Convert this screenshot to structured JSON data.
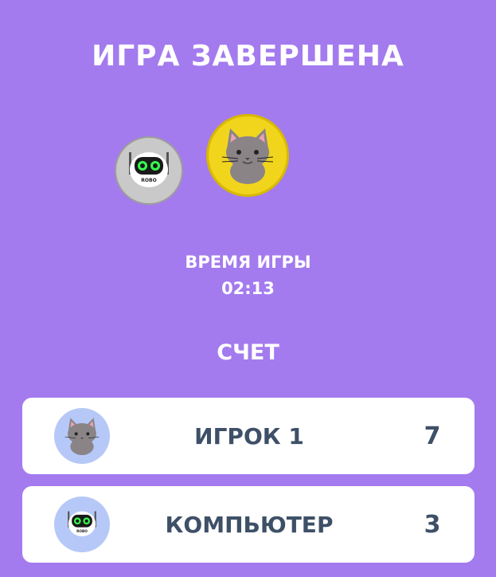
{
  "header": {
    "title": "ИГРА ЗАВЕРШЕНА"
  },
  "players_top": [
    {
      "name": "robot",
      "icon": "robot-icon",
      "badge": "ROBO",
      "bg": "#c9c9c9"
    },
    {
      "name": "cat",
      "icon": "cat-icon",
      "bg": "#f1d51d"
    }
  ],
  "game_time": {
    "label": "ВРЕМЯ ИГРЫ",
    "value": "02:13"
  },
  "score": {
    "title": "СЧЕТ",
    "rows": [
      {
        "name": "ИГРОК 1",
        "score": "7",
        "icon": "cat-icon"
      },
      {
        "name": "КОМПЬЮТЕР",
        "score": "3",
        "icon": "robot-icon",
        "badge": "ROBO"
      }
    ]
  },
  "colors": {
    "background": "#a37bee",
    "text": "#ffffff",
    "row_text": "#3e5067",
    "row_avatar_bg": "#b6c8f7"
  }
}
